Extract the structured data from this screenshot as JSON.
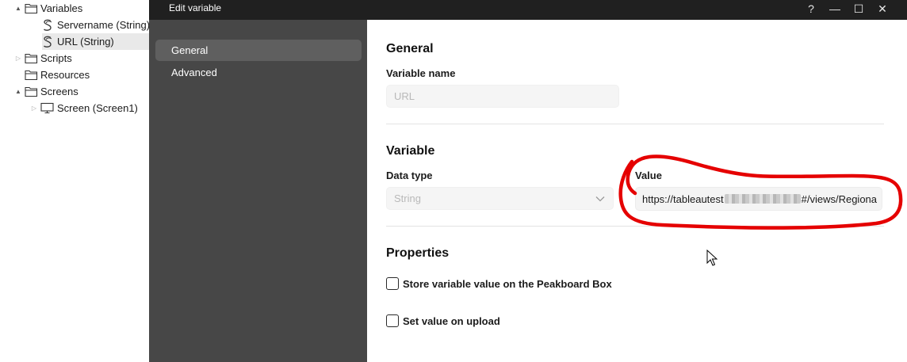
{
  "tree": {
    "items": [
      {
        "label": "Variables",
        "toggle": "▲",
        "expanded": true
      },
      {
        "label": "Servername (String)"
      },
      {
        "label": "URL (String)",
        "selected": true
      },
      {
        "label": "Scripts",
        "toggle": "▷",
        "expanded": false
      },
      {
        "label": "Resources"
      },
      {
        "label": "Screens",
        "toggle": "▲",
        "expanded": true
      },
      {
        "label": "Screen (Screen1)",
        "toggle": "▷",
        "expanded": false
      }
    ]
  },
  "dialog": {
    "title": "Edit variable",
    "window_buttons": {
      "help": "?",
      "minimize": "—",
      "maximize": "☐",
      "close": "✕"
    },
    "nav": [
      {
        "label": "General",
        "active": true
      },
      {
        "label": "Advanced",
        "active": false
      }
    ],
    "general": {
      "section_title": "General",
      "name_label": "Variable name",
      "name_value": "URL"
    },
    "variable": {
      "section_title": "Variable",
      "data_type_label": "Data type",
      "data_type_value": "String",
      "value_label": "Value",
      "value_prefix": "https://tableautest",
      "value_suffix": "#/views/Regiona"
    },
    "properties": {
      "section_title": "Properties",
      "checkboxes": [
        {
          "label": "Store variable value on the Peakboard Box",
          "checked": false
        },
        {
          "label": "Set value on upload",
          "checked": false
        }
      ]
    }
  },
  "colors": {
    "titlebar": "#202020",
    "sidenav": "#474747",
    "nav_active": "#5f5f5f",
    "annotation_ring": "#e50000"
  },
  "icons": {
    "folder": "folder-icon",
    "string_variable": "string-variable-icon",
    "screen": "monitor-icon",
    "dropdown": "chevron-down-icon"
  }
}
